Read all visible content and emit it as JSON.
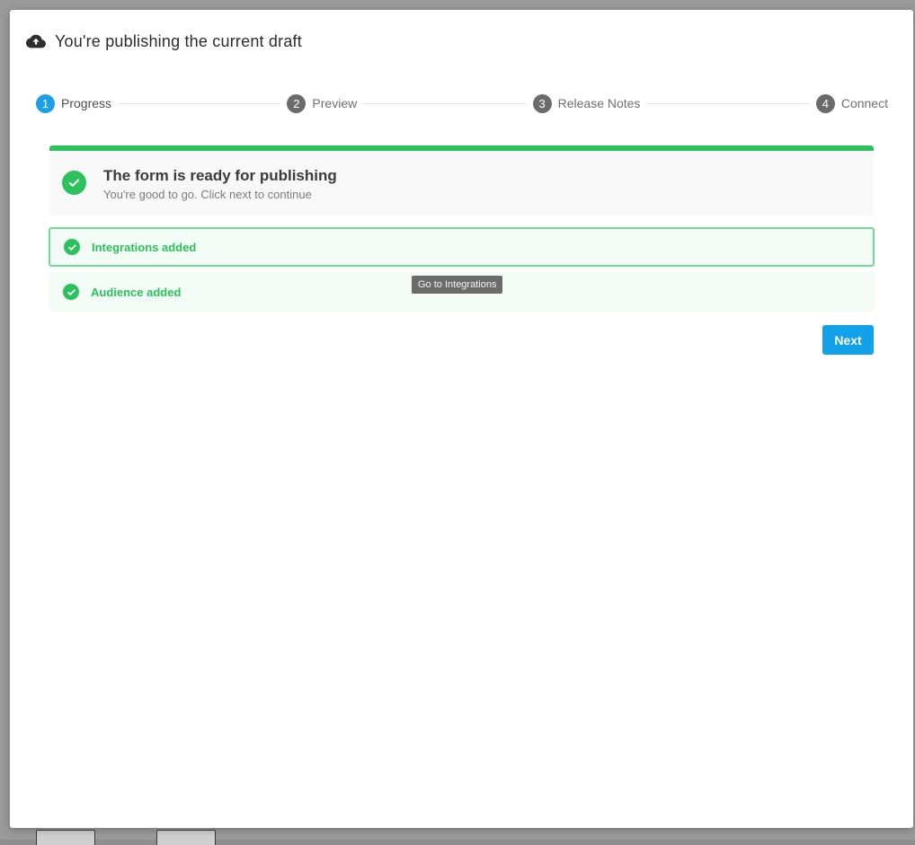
{
  "modal": {
    "title": "You're publishing the current draft",
    "header_icon": "cloud-upload-icon"
  },
  "stepper": {
    "steps": [
      {
        "number": "1",
        "label": "Progress",
        "active": true
      },
      {
        "number": "2",
        "label": "Preview",
        "active": false
      },
      {
        "number": "3",
        "label": "Release Notes",
        "active": false
      },
      {
        "number": "4",
        "label": "Connect",
        "active": false
      }
    ]
  },
  "status": {
    "title": "The form is ready for publishing",
    "subtitle": "You're good to go. Click next to continue",
    "icon": "check-circle-icon"
  },
  "checklist": [
    {
      "label": "Integrations added",
      "icon": "check-circle-icon",
      "focused": true
    },
    {
      "label": "Audience added",
      "icon": "check-circle-icon",
      "focused": false
    }
  ],
  "tooltip": {
    "text": "Go to Integrations"
  },
  "actions": {
    "next_label": "Next"
  },
  "colors": {
    "accent": "#13a2e9",
    "success": "#2cc15c",
    "success_bg": "#f2fbf5",
    "step_inactive": "#6b6b6b"
  }
}
